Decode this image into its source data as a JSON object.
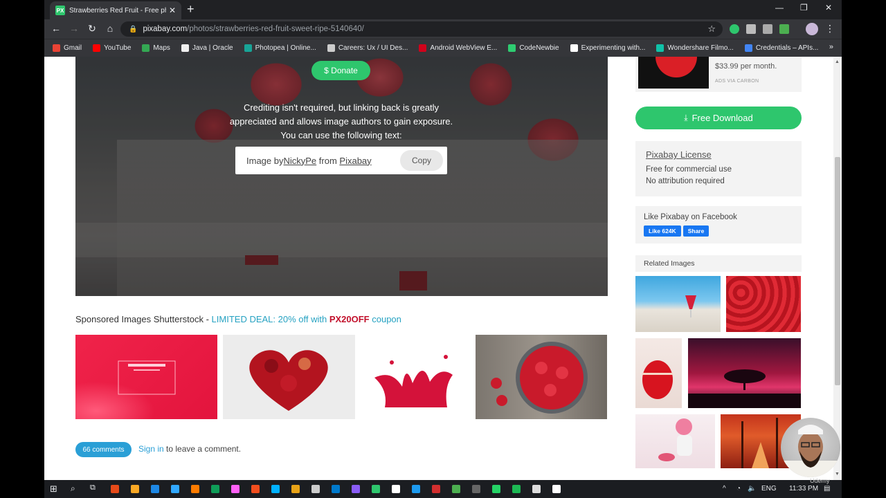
{
  "browser": {
    "tab_title": "Strawberries Red Fruit - Free pho",
    "tab_favicon": "PX",
    "url_host": "pixabay.com",
    "url_path": "/photos/strawberries-red-fruit-sweet-ripe-5140640/",
    "new_tab_icon": "+",
    "bookmarks": [
      {
        "label": "Gmail",
        "color": "#ea4335"
      },
      {
        "label": "YouTube",
        "color": "#ff0000"
      },
      {
        "label": "Maps",
        "color": "#34a853"
      },
      {
        "label": "Java | Oracle",
        "color": "#f0f0f0"
      },
      {
        "label": "Photopea | Online...",
        "color": "#18a497"
      },
      {
        "label": "Careers: Ux / UI Des...",
        "color": "#cccccc"
      },
      {
        "label": "Android WebView E...",
        "color": "#d0021b"
      },
      {
        "label": "CodeNewbie",
        "color": "#2ecc71"
      },
      {
        "label": "Experimenting with...",
        "color": "#ffffff"
      },
      {
        "label": "Wondershare Filmo...",
        "color": "#10c2a8"
      },
      {
        "label": "Credentials – APIs...",
        "color": "#4285f4"
      }
    ],
    "bookmarks_more": "»"
  },
  "hero": {
    "donate_label": "$ Donate",
    "credit_line1": "Crediting isn't required, but linking back is greatly",
    "credit_line2": "appreciated and allows image authors to gain exposure.",
    "credit_line3": "You can use the following text:",
    "attr_prefix": "Image by ",
    "attr_author": "NickyPe",
    "attr_middle": " from ",
    "attr_site": "Pixabay",
    "copy_label": "Copy"
  },
  "sponsored": {
    "prefix": "Sponsored Images Shutterstock - ",
    "deal": "LIMITED DEAL: 20% off with ",
    "code": "PX20OFF",
    "suffix": " coupon"
  },
  "comments": {
    "count_label": "66 comments",
    "signin_label": "Sign in",
    "signin_suffix": " to leave a comment."
  },
  "sidebar": {
    "ad_price": "$33.99 per month.",
    "ad_via": "ADS VIA CARBON",
    "download_label": "Free Download",
    "license_title": "Pixabay License",
    "license_line1": "Free for commercial use",
    "license_line2": "No attribution required",
    "fb_title": "Like Pixabay on Facebook",
    "fb_like": "Like 624K",
    "fb_share": "Share",
    "related_title": "Related Images"
  },
  "taskbar": {
    "lang": "ENG",
    "time": "11:33 PM"
  },
  "watermark": "Udemy",
  "colors": {
    "pixabay_green": "#2ec66d",
    "link_blue": "#2a9fd6",
    "coupon_red": "#c2102b"
  }
}
